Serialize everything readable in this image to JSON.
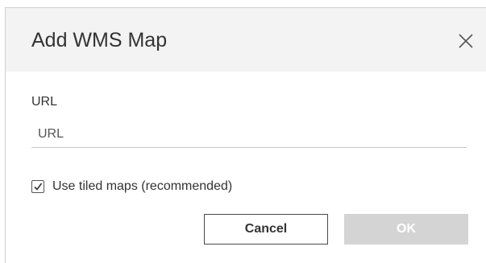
{
  "dialog": {
    "title": "Add WMS Map",
    "close_icon": "close-icon"
  },
  "url_field": {
    "label": "URL",
    "value": "",
    "placeholder": "URL"
  },
  "tiled_option": {
    "label": "Use tiled maps (recommended)",
    "checked": true,
    "icon": "checkmark-icon"
  },
  "buttons": {
    "cancel_label": "Cancel",
    "ok_label": "OK",
    "ok_enabled": false
  },
  "colors": {
    "header_bg": "#f3f3f3",
    "text": "#333333",
    "ok_disabled_bg": "#d4d4d4",
    "cancel_border": "#4a4a4a"
  }
}
